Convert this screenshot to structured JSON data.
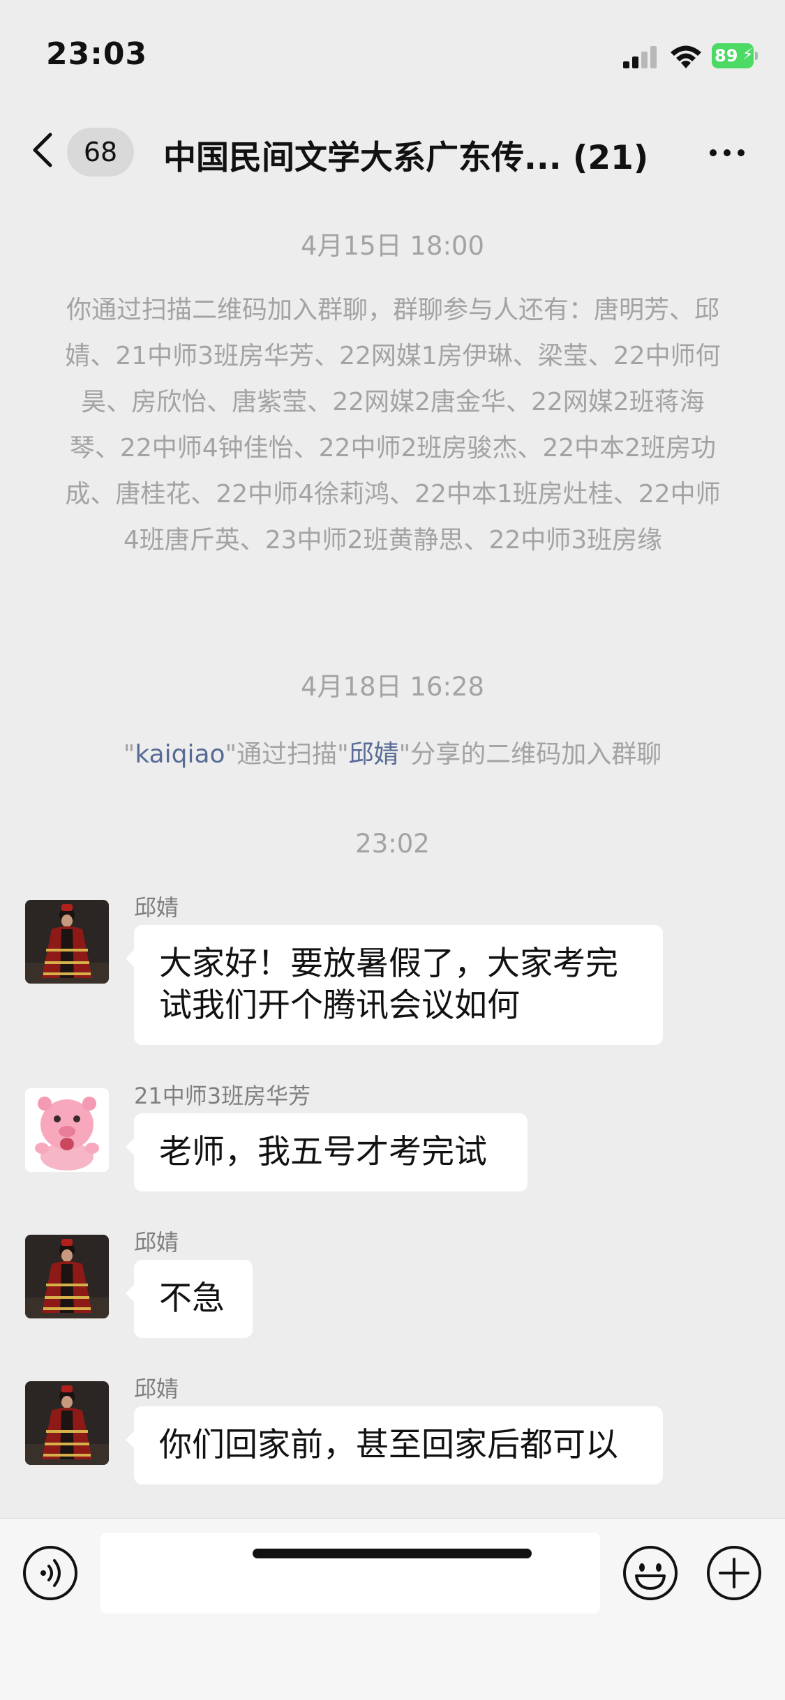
{
  "status_bar": {
    "time": "23:03",
    "battery": "89"
  },
  "nav": {
    "unread_count": "68",
    "title": "中国民间文学大系广东传... (21)"
  },
  "system": {
    "time_1": "4月15日 18:00",
    "join_notice": "你通过扫描二维码加入群聊，群聊参与人还有：唐明芳、邱婧、21中师3班房华芳、22网媒1房伊琳、梁莹、22中师何昊、房欣怡、唐紫莹、22网媒2唐金华、22网媒2班蒋海琴、22中师4钟佳怡、22中师2班房骏杰、22中本2班房功成、唐桂花、22中师4徐莉鸿、22中本1班房灶桂、22中师4班唐斤英、23中师2班黄静思、22中师3班房缘",
    "time_2": "4月18日 16:28",
    "scan_notice": {
      "quote_open": "\"",
      "user": "kaiqiao",
      "middle": "\"通过扫描\"",
      "sharer": "邱婧",
      "tail": "\"分享的二维码加入群聊"
    },
    "time_3": "23:02"
  },
  "messages": [
    {
      "sender": "邱婧",
      "text": "大家好！要放暑假了，大家考完试我们开个腾讯会议如何"
    },
    {
      "sender": "21中师3班房华芳",
      "text": "老师，我五号才考完试"
    },
    {
      "sender": "邱婧",
      "text": "不急"
    },
    {
      "sender": "邱婧",
      "text": "你们回家前，甚至回家后都可以"
    }
  ],
  "input": {
    "value": ""
  },
  "colors": {
    "background": "#ededed",
    "bubble": "#ffffff",
    "link": "#576b95",
    "battery": "#4cd964"
  }
}
